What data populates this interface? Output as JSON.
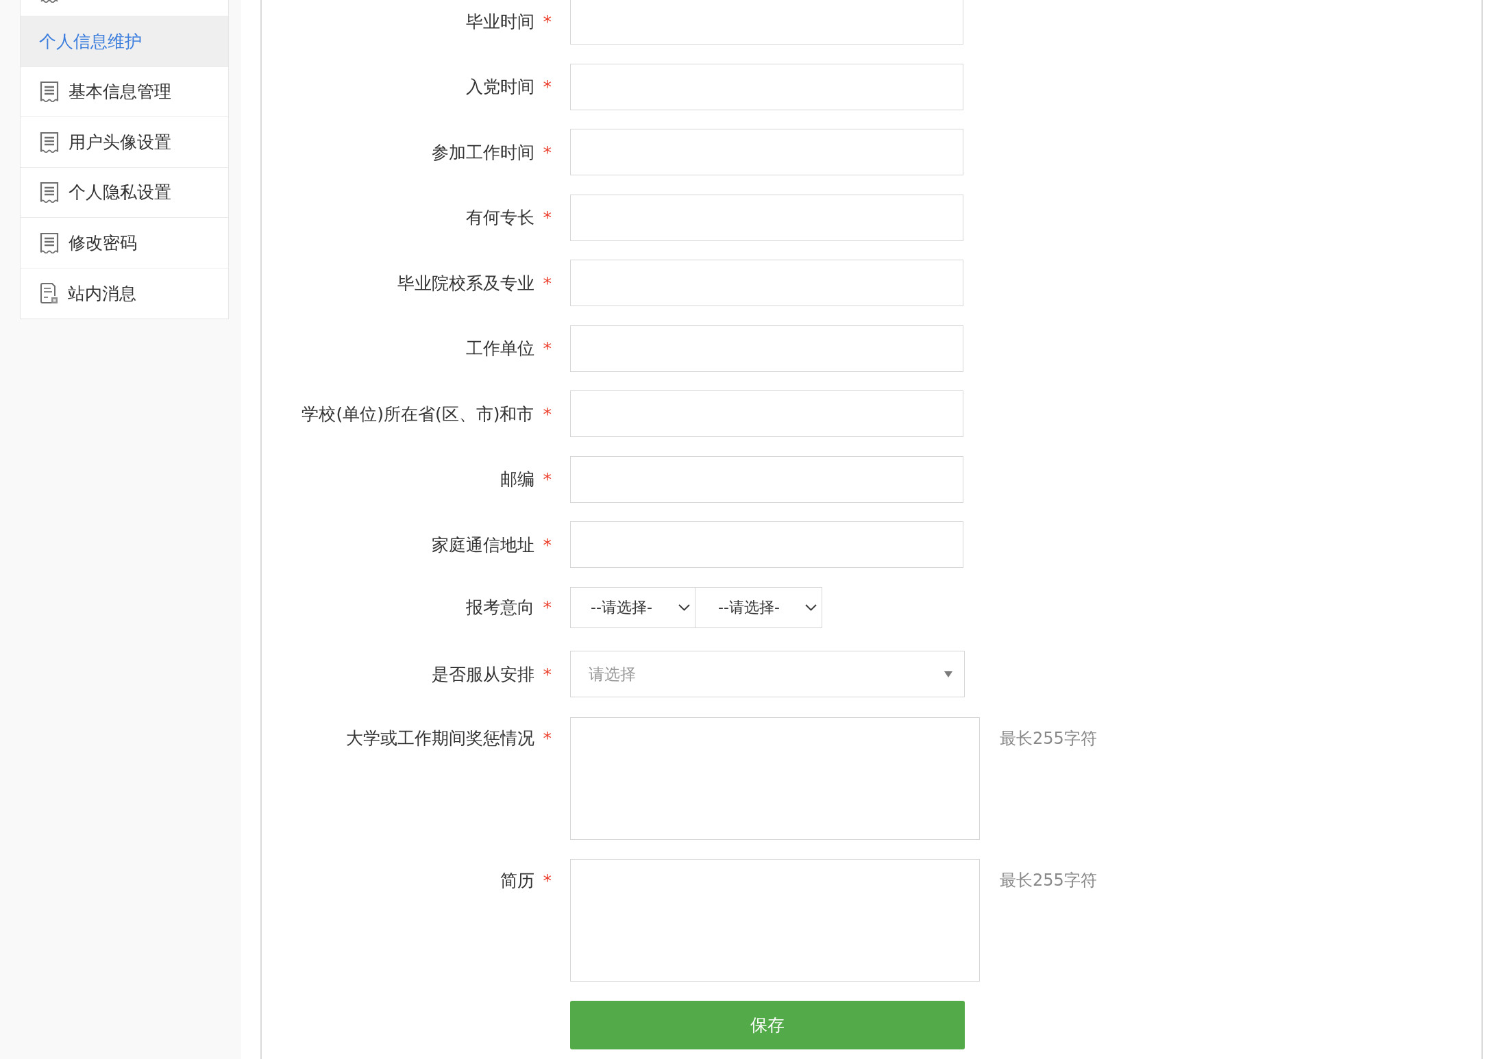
{
  "sidebar": {
    "items": [
      {
        "label": "个人信息维护",
        "kind": "group",
        "selected": true
      },
      {
        "label": "基本信息管理",
        "kind": "link",
        "selected": false
      },
      {
        "label": "用户头像设置",
        "kind": "link",
        "selected": false
      },
      {
        "label": "个人隐私设置",
        "kind": "link",
        "selected": false
      },
      {
        "label": "修改密码",
        "kind": "link",
        "selected": false
      },
      {
        "label": "站内消息",
        "kind": "link",
        "selected": false
      }
    ]
  },
  "form": {
    "fields": [
      {
        "label": "毕业时间",
        "required_mark": "*",
        "kind": "text"
      },
      {
        "label": "入党时间",
        "required_mark": "*",
        "kind": "text"
      },
      {
        "label": "参加工作时间",
        "required_mark": "*",
        "kind": "text"
      },
      {
        "label": "有何专长",
        "required_mark": "*",
        "kind": "text"
      },
      {
        "label": "毕业院校系及专业",
        "required_mark": "*",
        "kind": "text"
      },
      {
        "label": "工作单位",
        "required_mark": "*",
        "kind": "text"
      },
      {
        "label": "学校(单位)所在省(区、市)和市",
        "required_mark": "*",
        "kind": "text"
      },
      {
        "label": "邮编",
        "required_mark": "*",
        "kind": "text"
      },
      {
        "label": "家庭通信地址",
        "required_mark": "*",
        "kind": "text"
      },
      {
        "label": "报考意向",
        "required_mark": "*",
        "kind": "select_pair",
        "selects": [
          "--请选择-",
          "--请选择-"
        ]
      },
      {
        "label": "是否服从安排",
        "required_mark": "*",
        "kind": "dropdown",
        "placeholder": "请选择"
      },
      {
        "label": "大学或工作期间奖惩情况",
        "required_mark": "*",
        "kind": "textarea",
        "hint": "最长255字符"
      },
      {
        "label": "简历",
        "required_mark": "*",
        "kind": "textarea",
        "hint": "最长255字符"
      }
    ],
    "save_button": {
      "label": "保存"
    }
  }
}
